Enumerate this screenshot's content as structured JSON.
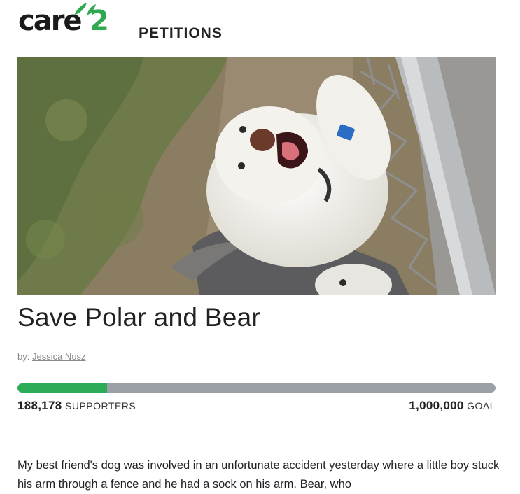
{
  "header": {
    "logo_word": "care",
    "logo_number": "2",
    "logo_suffix": "PETITIONS"
  },
  "petition": {
    "title": "Save Polar and Bear",
    "by_label": "by:",
    "author": "Jessica Nusz",
    "supporters_count": "188,178",
    "supporters_label": "SUPPORTERS",
    "goal_count": "1,000,000",
    "goal_label": "GOAL",
    "progress_fraction": 0.188,
    "body": "My best friend's dog was involved in an unfortunate accident yesterday where a little boy stuck his arm through a fence and he had a sock on his arm. Bear, who"
  },
  "colors": {
    "brand_green": "#2cab59",
    "track_gray": "#9aa0a6"
  }
}
